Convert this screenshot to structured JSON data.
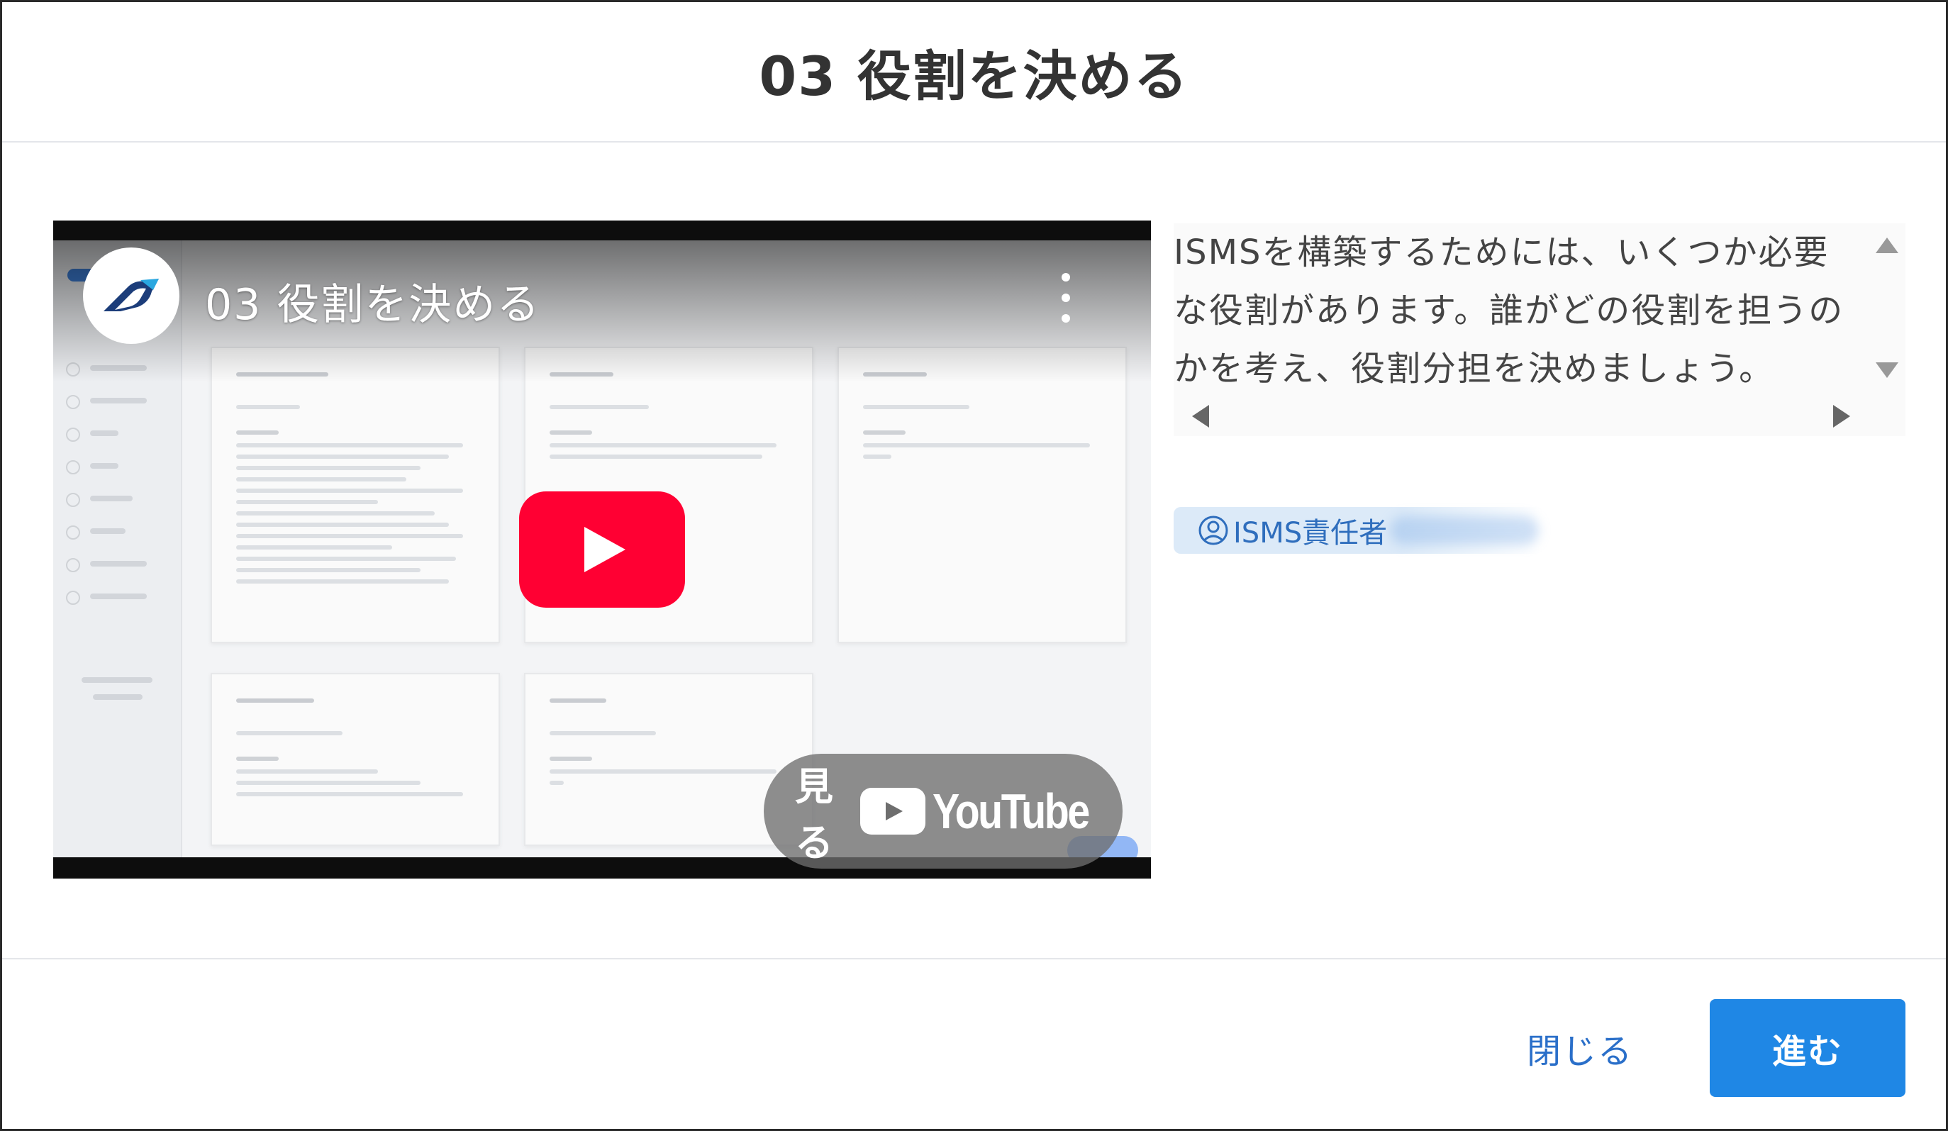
{
  "dialog": {
    "title": "03 役割を決める"
  },
  "video": {
    "title": "03 役割を決める",
    "watch_label": "見る",
    "platform_name": "YouTube",
    "brand_color": "#ff0033",
    "menu_icon": "kebab-menu-icon",
    "play_icon": "play-icon"
  },
  "description": {
    "text": "ISMSを構築するためには、いくつか必要な役割があります。誰がどの役割を担うのかを考え、役割分担を決めましょう。"
  },
  "role": {
    "icon": "user-circle-icon",
    "label": "ISMS責任者"
  },
  "footer": {
    "close_label": "閉じる",
    "next_label": "進む",
    "accent_color": "#1f87e5"
  }
}
